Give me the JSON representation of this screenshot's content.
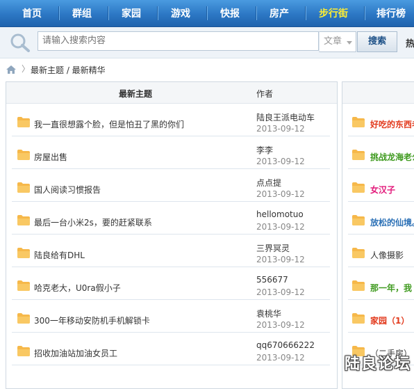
{
  "nav": {
    "items": [
      {
        "label": "首页",
        "active": false
      },
      {
        "label": "群组",
        "active": false
      },
      {
        "label": "家园",
        "active": false
      },
      {
        "label": "游戏",
        "active": false
      },
      {
        "label": "快报",
        "active": false
      },
      {
        "label": "房产",
        "active": false
      },
      {
        "label": "步行街",
        "active": true
      },
      {
        "label": "排行榜",
        "active": false
      }
    ]
  },
  "search": {
    "placeholder": "请输入搜索内容",
    "type_selected": "文章",
    "button_label": "搜索",
    "hot_label": "热"
  },
  "breadcrumb": {
    "text": "最新主题 / 最新精华"
  },
  "left_table": {
    "column_title": "最新主题",
    "column_author": "作者",
    "rows": [
      {
        "title": "我一直很想露个脸，但是怕丑了黑的你们",
        "author": "陆良王派电动车",
        "date": "2013-09-12"
      },
      {
        "title": "房屋出售",
        "author": "李李",
        "date": "2013-09-12"
      },
      {
        "title": "国人阅读习惯报告",
        "author": "点点提",
        "date": "2013-09-12"
      },
      {
        "title": "最后一台小米2s，要的赶紧联系",
        "author": "hellomotuo",
        "date": "2013-09-12"
      },
      {
        "title": "陆良给有DHL",
        "author": "三界冥灵",
        "date": "2013-09-12"
      },
      {
        "title": "哈克老大，U0ra假小子",
        "author": "556677",
        "date": "2013-09-12"
      },
      {
        "title": "300一年移动安防机手机解锁卡",
        "author": "袁桃华",
        "date": "2013-09-12"
      },
      {
        "title": "招收加油站加油女员工",
        "author": "qq670666222",
        "date": "2013-09-12"
      }
    ]
  },
  "right_table": {
    "rows": [
      {
        "title": "好吃的东西老",
        "color": "#e23a1d",
        "bold": true
      },
      {
        "title": "挑战龙海老公",
        "color": "#3f9a1f",
        "bold": true
      },
      {
        "title": "女汉子",
        "color": "#e2197a",
        "bold": true
      },
      {
        "title": "放松的仙境。",
        "color": "#2a6fb5",
        "bold": true
      },
      {
        "title": "人像摄影",
        "color": "#333333",
        "bold": false
      },
      {
        "title": "那一年，我",
        "color": "#3f9a1f",
        "bold": true
      },
      {
        "title": "家园（1）",
        "color": "#e23a1d",
        "bold": true
      },
      {
        "title": "（二手房）",
        "color": "#333333",
        "bold": false
      }
    ]
  },
  "watermark": "陆良论坛",
  "colors": {
    "nav_bg": "#2c77c4",
    "nav_active": "#ffee33",
    "folder": "#f6b84a"
  }
}
